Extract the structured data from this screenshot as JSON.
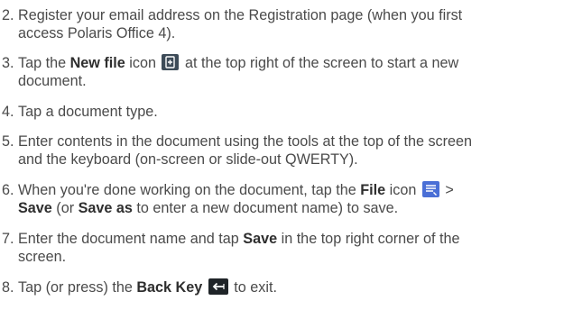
{
  "steps": [
    {
      "number": "2.",
      "line1": "Register your email address on the Registration page (when you first",
      "line2": "access Polaris Office 4)."
    },
    {
      "number": "3.",
      "pre": "Tap the ",
      "bold": "New file",
      "mid": " icon ",
      "icon": "new-file-icon",
      "post": " at the top right of the screen to start a new",
      "line2": "document."
    },
    {
      "number": "4.",
      "line1": "Tap a document type."
    },
    {
      "number": "5.",
      "line1": "Enter contents in the document using the tools at the top of the screen",
      "line2": "and the keyboard (on-screen or slide-out QWERTY)."
    },
    {
      "number": "6.",
      "pre": "When you're done working on the document, tap the ",
      "bold": "File",
      "mid": " icon ",
      "icon": "file-menu-icon",
      "post": " >",
      "bold2": "Save",
      "mid2": " (or ",
      "bold3": "Save as",
      "post2": " to enter a new document name) to save."
    },
    {
      "number": "7.",
      "pre": "Enter the document name and tap ",
      "bold": "Save",
      "post": " in the top right corner of the",
      "line2": "screen."
    },
    {
      "number": "8.",
      "pre": "Tap (or press) the ",
      "bold": "Back Key",
      "icon": "back-key-icon",
      "post": " to exit."
    }
  ]
}
